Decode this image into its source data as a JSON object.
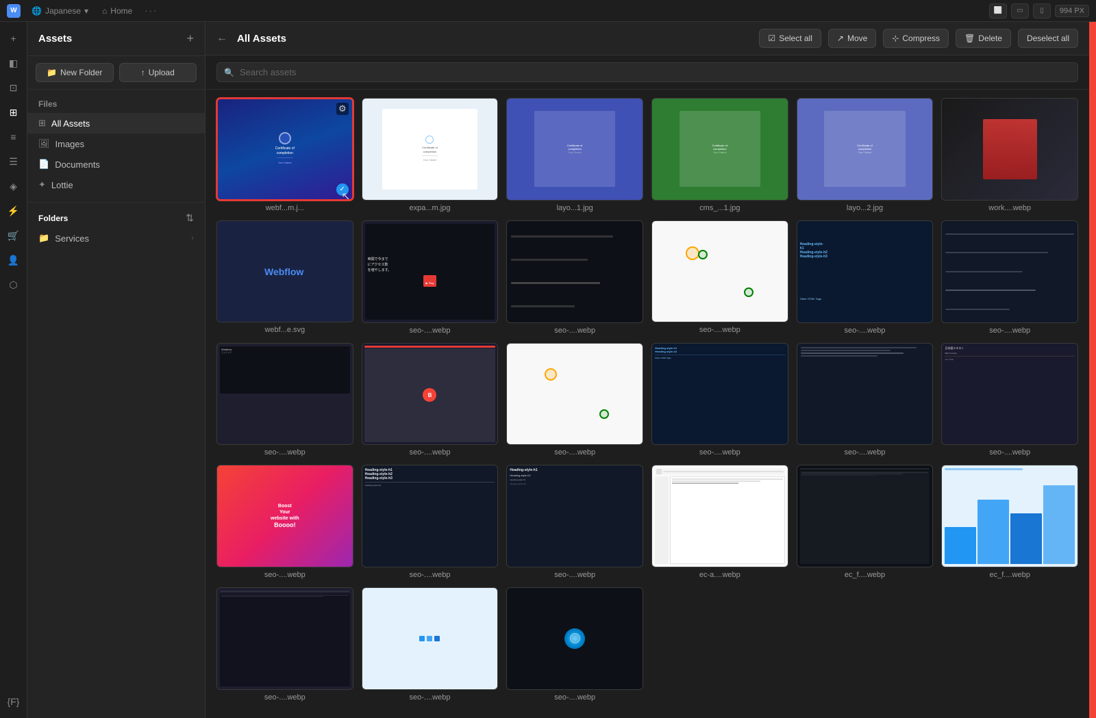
{
  "topNav": {
    "logoText": "W",
    "languageLabel": "Japanese",
    "homeLabel": "Home",
    "dotsLabel": "···",
    "icons": [
      "desktop",
      "tablet",
      "mobile"
    ],
    "pxLabel": "994 PX"
  },
  "sidebar": {
    "title": "Assets",
    "plusIcon": "+",
    "newFolderBtn": "New Folder",
    "uploadBtn": "Upload",
    "filesLabel": "Files",
    "fileItems": [
      {
        "id": "all-assets",
        "label": "All Assets",
        "icon": "⊞"
      },
      {
        "id": "images",
        "label": "Images",
        "icon": "🖼"
      },
      {
        "id": "documents",
        "label": "Documents",
        "icon": "📄"
      },
      {
        "id": "lottie",
        "label": "Lottie",
        "icon": "✦"
      }
    ],
    "foldersLabel": "Folders",
    "folders": [
      {
        "id": "services",
        "label": "Services",
        "icon": "📁"
      }
    ]
  },
  "main": {
    "toolbar": {
      "backIcon": "←",
      "title": "All Assets",
      "selectAllBtn": "Select all",
      "moveBtn": "Move",
      "compressBtn": "Compress",
      "deleteBtn": "Delete",
      "deselectAllBtn": "Deselect all"
    },
    "search": {
      "placeholder": "Search assets"
    },
    "assets": [
      {
        "id": 1,
        "name": "webf...m.j...",
        "type": "webp",
        "selected": true,
        "thumbType": "cert-blue"
      },
      {
        "id": 2,
        "name": "expa...m.jpg",
        "type": "jpg",
        "thumbType": "cert-white"
      },
      {
        "id": 3,
        "name": "layo...1.jpg",
        "type": "jpg",
        "thumbType": "cert-blue-solid"
      },
      {
        "id": 4,
        "name": "cms_...1.jpg",
        "type": "jpg",
        "thumbType": "cert-green"
      },
      {
        "id": 5,
        "name": "layo...2.jpg",
        "type": "jpg",
        "thumbType": "cert-indigo"
      },
      {
        "id": 6,
        "name": "work....webp",
        "type": "webp",
        "thumbType": "dark-scene"
      },
      {
        "id": 7,
        "name": "webf...e.svg",
        "type": "svg",
        "thumbType": "webflow"
      },
      {
        "id": 8,
        "name": "seo-....webp",
        "type": "webp",
        "thumbType": "jp-dark"
      },
      {
        "id": 9,
        "name": "seo-....webp",
        "type": "webp",
        "thumbType": "dark-ui"
      },
      {
        "id": 10,
        "name": "seo-....webp",
        "type": "webp",
        "thumbType": "light-ui"
      },
      {
        "id": 11,
        "name": "seo-....webp",
        "type": "webp",
        "thumbType": "dark-blue-ui"
      },
      {
        "id": 12,
        "name": "seo-....webp",
        "type": "webp",
        "thumbType": "type-dark"
      },
      {
        "id": 13,
        "name": "seo-....webp",
        "type": "webp",
        "thumbType": "dark-editor"
      },
      {
        "id": 14,
        "name": "seo-....webp",
        "type": "webp",
        "thumbType": "colorful"
      },
      {
        "id": 15,
        "name": "seo-....webp",
        "type": "webp",
        "thumbType": "light-ui"
      },
      {
        "id": 16,
        "name": "seo-....webp",
        "type": "webp",
        "thumbType": "dark-ui"
      },
      {
        "id": 17,
        "name": "seo-....webp",
        "type": "webp",
        "thumbType": "dark-blue-ui"
      },
      {
        "id": 18,
        "name": "seo-....webp",
        "type": "webp",
        "thumbType": "type-dark"
      },
      {
        "id": 19,
        "name": "seo-....webp",
        "type": "webp",
        "thumbType": "dark-editor"
      },
      {
        "id": 20,
        "name": "seo-....webp",
        "type": "webp",
        "thumbType": "jp-dark"
      },
      {
        "id": 21,
        "name": "seo-....webp",
        "type": "webp",
        "thumbType": "pink-purple"
      },
      {
        "id": 22,
        "name": "seo-....webp",
        "type": "webp",
        "thumbType": "type-dark"
      },
      {
        "id": 23,
        "name": "seo-....webp",
        "type": "webp",
        "thumbType": "type-dark"
      },
      {
        "id": 24,
        "name": "ec-a....webp",
        "type": "webp",
        "thumbType": "white-product"
      },
      {
        "id": 25,
        "name": "ec_f....webp",
        "type": "webp",
        "thumbType": "type-dark"
      },
      {
        "id": 26,
        "name": "ec_f....webp",
        "type": "webp",
        "thumbType": "blue-chart"
      },
      {
        "id": 27,
        "name": "...",
        "type": "webp",
        "thumbType": "dark-editor"
      },
      {
        "id": 28,
        "name": "...",
        "type": "webp",
        "thumbType": "colorful"
      }
    ]
  },
  "iconBar": {
    "items": [
      {
        "id": "plus",
        "icon": "+",
        "label": "add-icon"
      },
      {
        "id": "layers",
        "icon": "◧",
        "label": "layers-icon"
      },
      {
        "id": "components",
        "icon": "⊡",
        "label": "components-icon"
      },
      {
        "id": "assets",
        "icon": "⊞",
        "label": "assets-icon"
      },
      {
        "id": "cms",
        "icon": "≡",
        "label": "cms-icon"
      },
      {
        "id": "pages",
        "icon": "☰",
        "label": "pages-icon"
      },
      {
        "id": "style",
        "icon": "◈",
        "label": "style-icon"
      },
      {
        "id": "interactions",
        "icon": "⚡",
        "label": "interactions-icon"
      },
      {
        "id": "ecomm",
        "icon": "🛍",
        "label": "ecomm-icon"
      },
      {
        "id": "users",
        "icon": "👤",
        "label": "users-icon"
      },
      {
        "id": "logic",
        "icon": "⬡",
        "label": "logic-icon"
      },
      {
        "id": "vars",
        "icon": "{F}",
        "label": "vars-icon"
      }
    ]
  }
}
